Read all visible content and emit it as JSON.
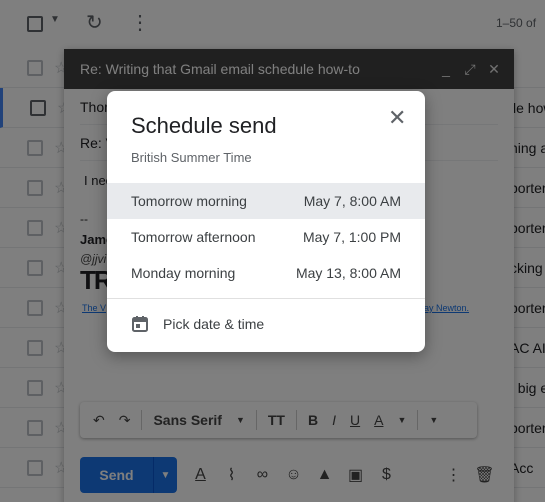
{
  "inbox": {
    "range_text": "1–50 of",
    "row_snippets": [
      "",
      "le how",
      "ning a",
      "porter",
      "porter",
      "cking",
      "porter",
      "AC AI",
      ", big e",
      "porter",
      "Acc"
    ]
  },
  "compose": {
    "title": "Re: Writing that Gmail email schedule how-to",
    "to_preview": "Thon",
    "subject_preview": "Re: V",
    "body_preview": "I nee",
    "sig_dash": "--",
    "sig_name": "Jame",
    "sig_handle": "@jjvi",
    "sig_logo": "TR",
    "sig_link_left": "The V",
    "sig_link_right": "ay Newton.",
    "format": {
      "font": "Sans Serif",
      "size_icon": "TT",
      "bold": "B",
      "italic": "I",
      "underline": "U",
      "color": "A"
    },
    "send_label": "Send"
  },
  "dialog": {
    "title": "Schedule send",
    "timezone": "British Summer Time",
    "options": [
      {
        "label": "Tomorrow morning",
        "time": "May 7, 8:00 AM"
      },
      {
        "label": "Tomorrow afternoon",
        "time": "May 7, 1:00 PM"
      },
      {
        "label": "Monday morning",
        "time": "May 13, 8:00 AM"
      }
    ],
    "pick_label": "Pick date & time"
  },
  "colors": {
    "accent": "#1a73e8",
    "compose_header": "#404040",
    "highlight_row": "#e8eaed"
  }
}
